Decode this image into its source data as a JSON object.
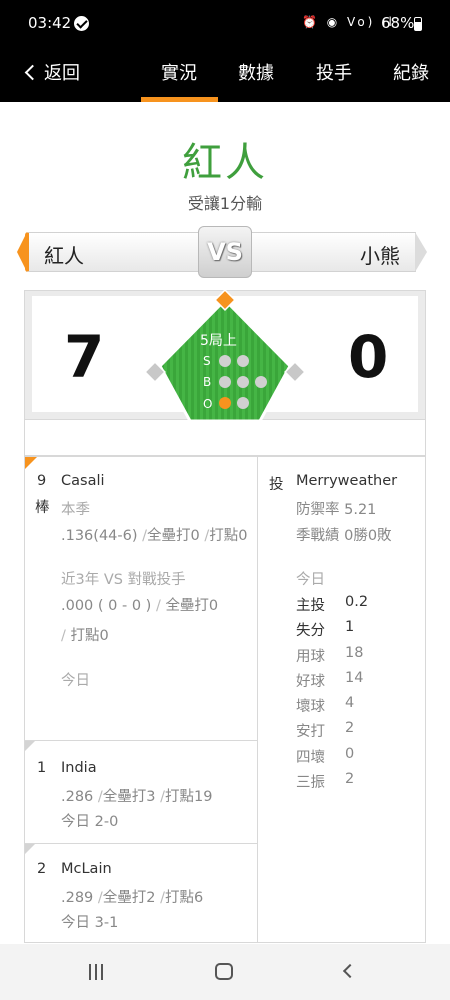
{
  "status_bar": {
    "time": "03:42",
    "icons": "⏰ ◉ Vo) ıl",
    "battery": "68%"
  },
  "nav": {
    "back_label": "返回",
    "tabs": [
      "實況",
      "數據",
      "投手",
      "紀錄"
    ],
    "active_tab": "實況"
  },
  "header": {
    "title": "紅人",
    "subtitle": "受讓1分輸"
  },
  "matchup": {
    "away_team": "紅人",
    "vs_label": "VS",
    "home_team": "小熊"
  },
  "scoreboard": {
    "away_score": "7",
    "home_score": "0",
    "inning": "5局上",
    "count_labels": [
      "S",
      "B",
      "O"
    ],
    "strikes": 0,
    "balls": 0,
    "outs": 1,
    "accent_color": "#f7931e",
    "field_color": "#3aa63a"
  },
  "batter": {
    "order": "9",
    "order_suffix": "棒",
    "name": "Casali",
    "season_label": "本季",
    "season_avg": ".136(44-6)",
    "season_hr": "全壘打0",
    "season_rbi": "打點0",
    "vs_label": "近3年 VS 對戰投手",
    "vs_avg": ".000 ( 0 - 0 )",
    "vs_hr": "全壘打0",
    "vs_rbi": "打點0",
    "today_label": "今日"
  },
  "next_batters": [
    {
      "order": "1",
      "name": "India",
      "avg": ".286",
      "hr": "全壘打3",
      "rbi": "打點19",
      "today": "今日 2-0"
    },
    {
      "order": "2",
      "name": "McLain",
      "avg": ".289",
      "hr": "全壘打2",
      "rbi": "打點6",
      "today": "今日 3-1"
    }
  ],
  "pitcher": {
    "role": "投",
    "name": "Merryweather",
    "era": "防禦率 5.21",
    "record": "季戰績 0勝0敗",
    "today_label": "今日",
    "stats": [
      {
        "label": "主投",
        "value": "0.2"
      },
      {
        "label": "失分",
        "value": "1"
      },
      {
        "label": "用球",
        "value": "18"
      },
      {
        "label": "好球",
        "value": "14"
      },
      {
        "label": "壞球",
        "value": "4"
      },
      {
        "label": "安打",
        "value": "2"
      },
      {
        "label": "四壞",
        "value": "0"
      },
      {
        "label": "三振",
        "value": "2"
      }
    ]
  }
}
